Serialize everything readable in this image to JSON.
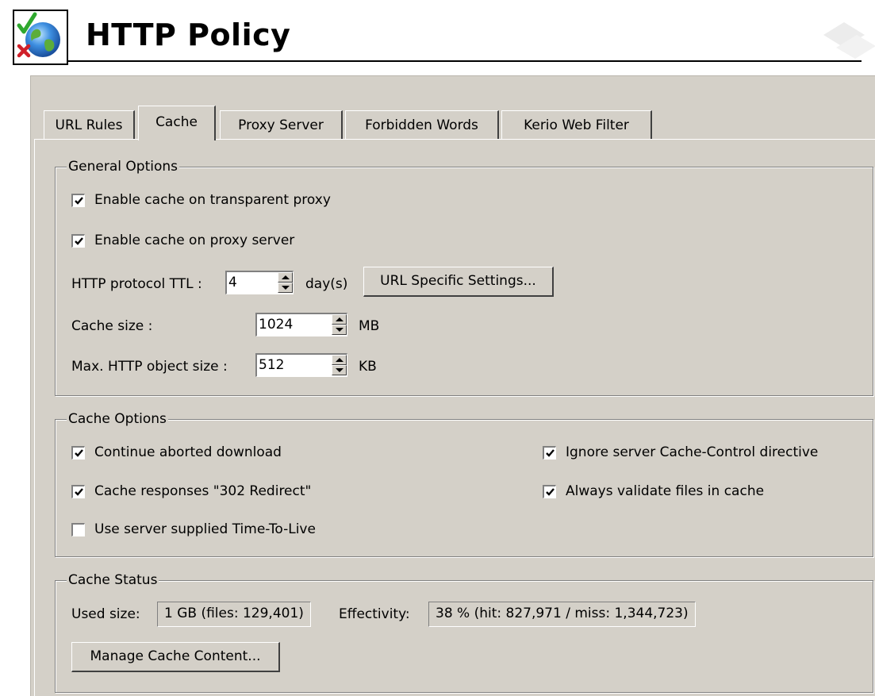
{
  "header": {
    "title": "HTTP Policy",
    "icon": "policy-globe-check-icon"
  },
  "tabs": [
    {
      "label": "URL Rules",
      "active": false
    },
    {
      "label": "Cache",
      "active": true
    },
    {
      "label": "Proxy Server",
      "active": false
    },
    {
      "label": "Forbidden Words",
      "active": false
    },
    {
      "label": "Kerio Web Filter",
      "active": false
    }
  ],
  "general_options": {
    "legend": "General Options",
    "enable_transparent": {
      "label": "Enable cache on transparent proxy",
      "checked": true
    },
    "enable_proxy": {
      "label": "Enable cache on proxy server",
      "checked": true
    },
    "ttl_label": "HTTP protocol TTL :",
    "ttl_value": "4",
    "ttl_unit": "day(s)",
    "url_specific_button": "URL Specific Settings...",
    "cache_size_label": "Cache size :",
    "cache_size_value": "1024",
    "cache_size_unit": "MB",
    "max_object_label": "Max. HTTP object size :",
    "max_object_value": "512",
    "max_object_unit": "KB"
  },
  "cache_options": {
    "legend": "Cache Options",
    "continue_aborted": {
      "label": "Continue aborted download",
      "checked": true
    },
    "cache_302": {
      "label": "Cache responses \"302 Redirect\"",
      "checked": true
    },
    "server_ttl": {
      "label": "Use server supplied Time-To-Live",
      "checked": false
    },
    "ignore_cache_control": {
      "label": "Ignore server Cache-Control directive",
      "checked": true
    },
    "always_validate": {
      "label": "Always validate files in cache",
      "checked": true
    }
  },
  "cache_status": {
    "legend": "Cache Status",
    "used_size_label": "Used size:",
    "used_size_value": "1 GB (files: 129,401)",
    "effectivity_label": "Effectivity:",
    "effectivity_value": "38 % (hit: 827,971 / miss: 1,344,723)",
    "manage_button": "Manage Cache Content..."
  },
  "colors": {
    "dialog_bg": "#d4d0c8",
    "check_green": "#2fa82f",
    "cross_red": "#d0202a"
  }
}
